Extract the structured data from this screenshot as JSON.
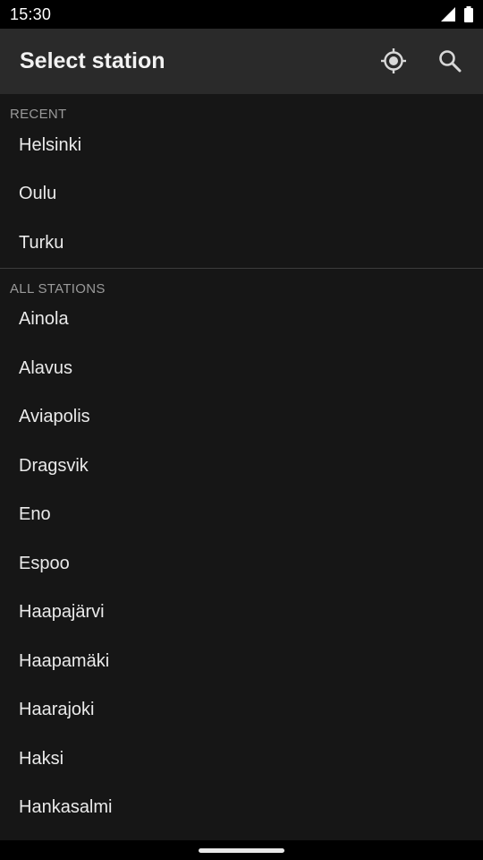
{
  "status_bar": {
    "time": "15:30",
    "signal_icon": "cell-signal-icon",
    "battery_icon": "battery-icon"
  },
  "app_bar": {
    "title": "Select station",
    "locate_icon": "my-location-icon",
    "search_icon": "search-icon"
  },
  "recent": {
    "header": "RECENT",
    "items": [
      "Helsinki",
      "Oulu",
      "Turku"
    ]
  },
  "all_stations": {
    "header": "ALL STATIONS",
    "items": [
      "Ainola",
      "Alavus",
      "Aviapolis",
      "Dragsvik",
      "Eno",
      "Espoo",
      "Haapajärvi",
      "Haapamäki",
      "Haarajoki",
      "Haksi",
      "Hankasalmi"
    ]
  },
  "colors": {
    "app_bar_bg": "#2a2a2a",
    "content_bg": "#161616",
    "header_text": "#9a9a9a",
    "item_text": "#eaeaea"
  }
}
